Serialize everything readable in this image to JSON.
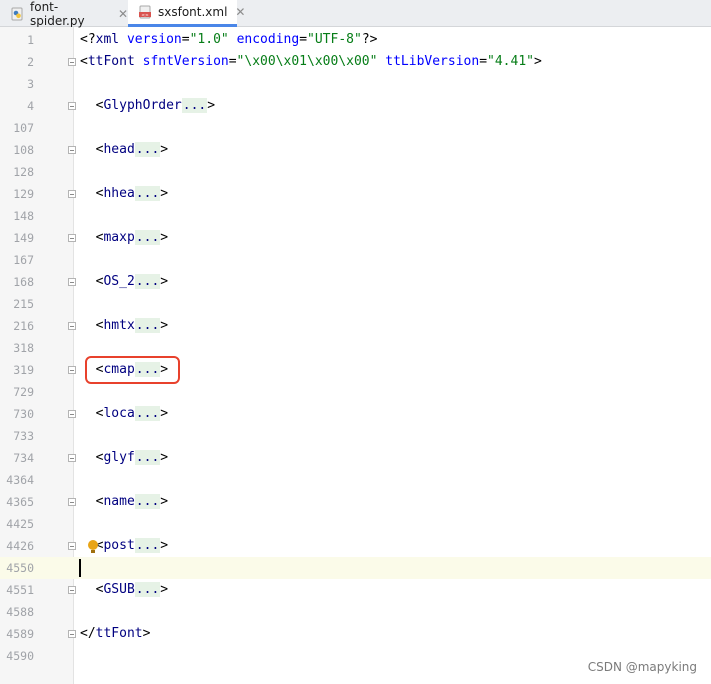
{
  "tabs": [
    {
      "label": "font-spider.py",
      "icon": "python-file-icon",
      "close": "✕"
    },
    {
      "label": "sxsfont.xml",
      "icon": "xml-file-icon",
      "close": "✕"
    }
  ],
  "lines": [
    {
      "num": "1",
      "segments": [
        {
          "t": "<?",
          "c": "pi"
        },
        {
          "t": "xml",
          "c": "tag"
        },
        {
          "t": " ",
          "c": "punc"
        },
        {
          "t": "version",
          "c": "attr"
        },
        {
          "t": "=",
          "c": "punc"
        },
        {
          "t": "\"1.0\"",
          "c": "val"
        },
        {
          "t": " ",
          "c": "punc"
        },
        {
          "t": "encoding",
          "c": "attr"
        },
        {
          "t": "=",
          "c": "punc"
        },
        {
          "t": "\"UTF-8\"",
          "c": "val"
        },
        {
          "t": "?>",
          "c": "pi"
        }
      ]
    },
    {
      "num": "2",
      "fold": true,
      "segments": [
        {
          "t": "<",
          "c": "punc"
        },
        {
          "t": "ttFont",
          "c": "tag"
        },
        {
          "t": " ",
          "c": "punc"
        },
        {
          "t": "sfntVersion",
          "c": "attr"
        },
        {
          "t": "=",
          "c": "punc"
        },
        {
          "t": "\"\\x00\\x01\\x00\\x00\"",
          "c": "val"
        },
        {
          "t": " ",
          "c": "punc"
        },
        {
          "t": "ttLibVersion",
          "c": "attr"
        },
        {
          "t": "=",
          "c": "punc"
        },
        {
          "t": "\"4.41\"",
          "c": "val"
        },
        {
          "t": ">",
          "c": "punc"
        }
      ]
    },
    {
      "num": "3",
      "segments": []
    },
    {
      "num": "4",
      "fold": true,
      "segments": [
        {
          "t": "  <",
          "c": "punc"
        },
        {
          "t": "GlyphOrder",
          "c": "tag"
        },
        {
          "t": "...",
          "c": "dots"
        },
        {
          "t": ">",
          "c": "punc"
        }
      ]
    },
    {
      "num": "107",
      "segments": []
    },
    {
      "num": "108",
      "fold": true,
      "segments": [
        {
          "t": "  <",
          "c": "punc"
        },
        {
          "t": "head",
          "c": "tag"
        },
        {
          "t": "...",
          "c": "dots"
        },
        {
          "t": ">",
          "c": "punc"
        }
      ]
    },
    {
      "num": "128",
      "segments": []
    },
    {
      "num": "129",
      "fold": true,
      "segments": [
        {
          "t": "  <",
          "c": "punc"
        },
        {
          "t": "hhea",
          "c": "tag"
        },
        {
          "t": "...",
          "c": "dots"
        },
        {
          "t": ">",
          "c": "punc"
        }
      ]
    },
    {
      "num": "148",
      "segments": []
    },
    {
      "num": "149",
      "fold": true,
      "segments": [
        {
          "t": "  <",
          "c": "punc"
        },
        {
          "t": "maxp",
          "c": "tag"
        },
        {
          "t": "...",
          "c": "dots"
        },
        {
          "t": ">",
          "c": "punc"
        }
      ]
    },
    {
      "num": "167",
      "segments": []
    },
    {
      "num": "168",
      "fold": true,
      "segments": [
        {
          "t": "  <",
          "c": "punc"
        },
        {
          "t": "OS_2",
          "c": "tag"
        },
        {
          "t": "...",
          "c": "dots"
        },
        {
          "t": ">",
          "c": "punc"
        }
      ]
    },
    {
      "num": "215",
      "segments": []
    },
    {
      "num": "216",
      "fold": true,
      "segments": [
        {
          "t": "  <",
          "c": "punc"
        },
        {
          "t": "hmtx",
          "c": "tag"
        },
        {
          "t": "...",
          "c": "dots"
        },
        {
          "t": ">",
          "c": "punc"
        }
      ]
    },
    {
      "num": "318",
      "segments": []
    },
    {
      "num": "319",
      "fold": true,
      "highlight": true,
      "segments": [
        {
          "t": "  <",
          "c": "punc"
        },
        {
          "t": "cmap",
          "c": "tag"
        },
        {
          "t": "...",
          "c": "dots"
        },
        {
          "t": ">",
          "c": "punc"
        }
      ]
    },
    {
      "num": "729",
      "segments": []
    },
    {
      "num": "730",
      "fold": true,
      "segments": [
        {
          "t": "  <",
          "c": "punc"
        },
        {
          "t": "loca",
          "c": "tag"
        },
        {
          "t": "...",
          "c": "dots"
        },
        {
          "t": ">",
          "c": "punc"
        }
      ]
    },
    {
      "num": "733",
      "segments": []
    },
    {
      "num": "734",
      "fold": true,
      "segments": [
        {
          "t": "  <",
          "c": "punc"
        },
        {
          "t": "glyf",
          "c": "tag"
        },
        {
          "t": "...",
          "c": "dots"
        },
        {
          "t": ">",
          "c": "punc"
        }
      ]
    },
    {
      "num": "4364",
      "segments": []
    },
    {
      "num": "4365",
      "fold": true,
      "segments": [
        {
          "t": "  <",
          "c": "punc"
        },
        {
          "t": "name",
          "c": "tag"
        },
        {
          "t": "...",
          "c": "dots"
        },
        {
          "t": ">",
          "c": "punc"
        }
      ]
    },
    {
      "num": "4425",
      "segments": []
    },
    {
      "num": "4426",
      "fold": true,
      "bulb": true,
      "segments": [
        {
          "t": "  <",
          "c": "punc"
        },
        {
          "t": "post",
          "c": "tag"
        },
        {
          "t": "...",
          "c": "dots"
        },
        {
          "t": ">",
          "c": "punc"
        }
      ]
    },
    {
      "num": "4550",
      "current": true,
      "segments": []
    },
    {
      "num": "4551",
      "fold": true,
      "segments": [
        {
          "t": "  <",
          "c": "punc"
        },
        {
          "t": "GSUB",
          "c": "tag"
        },
        {
          "t": "...",
          "c": "dots"
        },
        {
          "t": ">",
          "c": "punc"
        }
      ]
    },
    {
      "num": "4588",
      "segments": []
    },
    {
      "num": "4589",
      "fold": true,
      "segments": [
        {
          "t": "</",
          "c": "punc"
        },
        {
          "t": "ttFont",
          "c": "tag"
        },
        {
          "t": ">",
          "c": "punc"
        }
      ]
    },
    {
      "num": "4590",
      "segments": []
    }
  ],
  "watermark": "CSDN @mapyking",
  "colors": {
    "highlight_box": "#e8412c",
    "tab_accent": "#4a86e8",
    "tag": "#000080",
    "attr": "#0000ff",
    "value": "#067d17"
  }
}
